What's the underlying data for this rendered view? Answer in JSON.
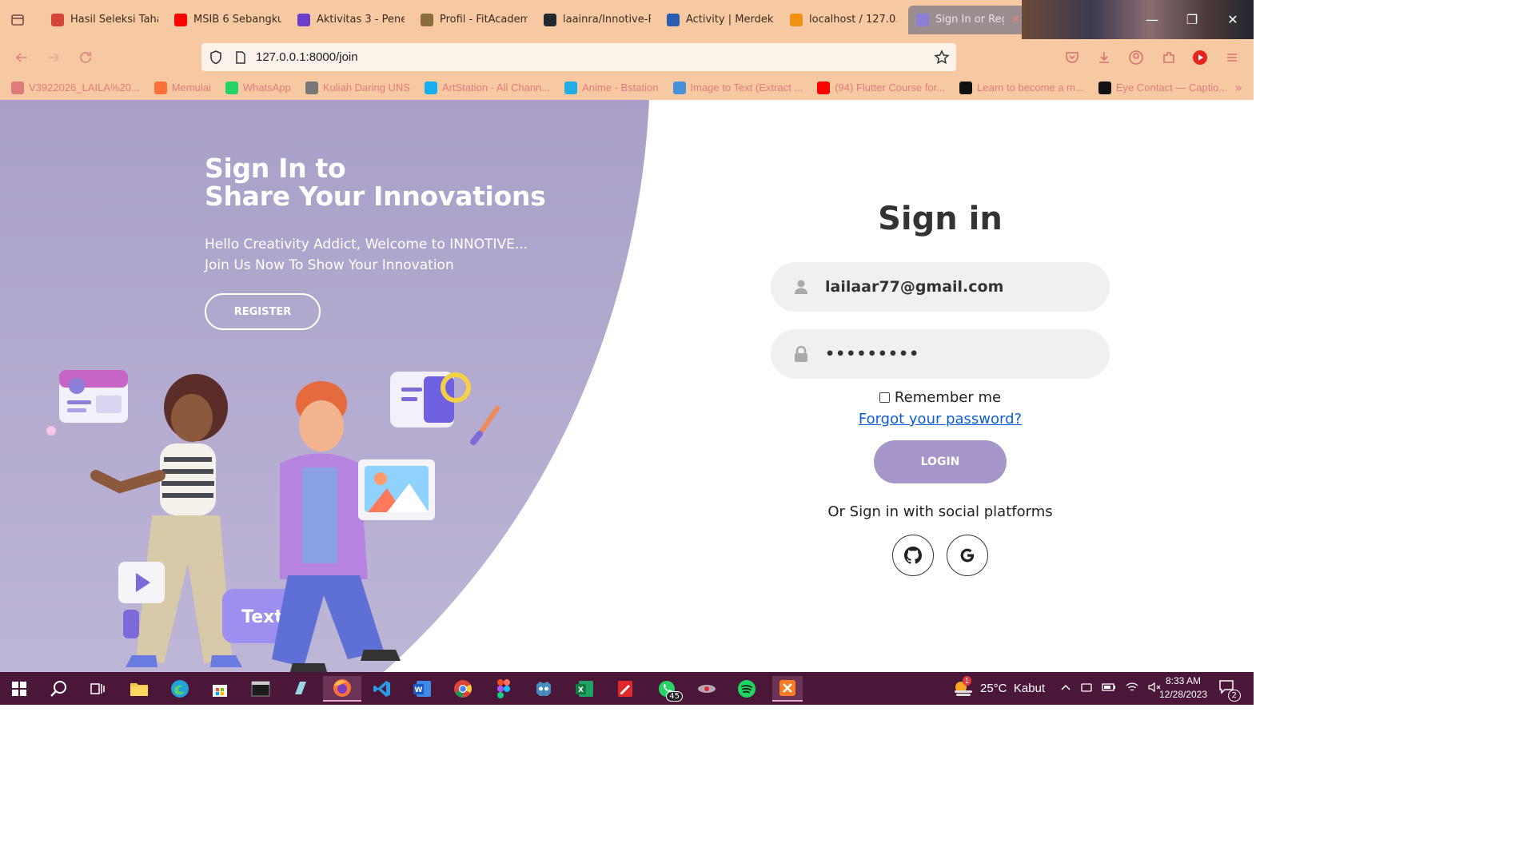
{
  "browser": {
    "tabs": [
      {
        "label": "Hasil Seleksi Tahap",
        "icon": "gmail-icon",
        "color": "#d44638"
      },
      {
        "label": "MSIB 6 Sebangku",
        "icon": "youtube-icon",
        "color": "#ff0000"
      },
      {
        "label": "Aktivitas 3 - Pener",
        "icon": "square-icon",
        "color": "#6b3ec9"
      },
      {
        "label": "Profil - FitAcadem",
        "icon": "cap-icon",
        "color": "#8a6d3b"
      },
      {
        "label": "laainra/Innotive-P",
        "icon": "github-icon",
        "color": "#24292f"
      },
      {
        "label": "Activity | Merdeka",
        "icon": "kampus-icon",
        "color": "#2a5db0"
      },
      {
        "label": "localhost / 127.0.0",
        "icon": "phpmyadmin-icon",
        "color": "#f29111"
      },
      {
        "label": "Sign In or Regi",
        "icon": "loading-icon",
        "color": "#8a7ed6",
        "active": true
      }
    ],
    "url": "127.0.0.1:8000/join",
    "bookmarks": [
      {
        "label": "V3922026_LAILA%20...",
        "icon": "globe-icon",
        "color": "#e07b7b"
      },
      {
        "label": "Memulai",
        "icon": "firefox-icon",
        "color": "#ff7139"
      },
      {
        "label": "WhatsApp",
        "icon": "whatsapp-icon",
        "color": "#25d366"
      },
      {
        "label": "Kuliah Daring UNS",
        "icon": "uns-icon",
        "color": "#777777"
      },
      {
        "label": "ArtStation - All Chann...",
        "icon": "artstation-icon",
        "color": "#13aff0"
      },
      {
        "label": "Anime - Bstation",
        "icon": "bstation-icon",
        "color": "#23ade5"
      },
      {
        "label": "Image to Text (Extract ...",
        "icon": "image-text-icon",
        "color": "#4a90d9"
      },
      {
        "label": "(94) Flutter Course for...",
        "icon": "youtube-icon",
        "color": "#ff0000"
      },
      {
        "label": "Learn to become a m...",
        "icon": "roadmap-icon",
        "color": "#111111"
      },
      {
        "label": "Eye Contact — Captio...",
        "icon": "captions-icon",
        "color": "#111111"
      }
    ]
  },
  "hero": {
    "title_line1": "Sign In to",
    "title_line2": "Share Your Innovations",
    "subtitle_line1": "Hello Creativity Addict, Welcome to INNOTIVE...",
    "subtitle_line2": "Join Us Now To Show Your Innovation",
    "register_label": "REGISTER",
    "illustration_text": "Text"
  },
  "form": {
    "title": "Sign in",
    "email_value": "lailaar77@gmail.com",
    "password_value": "•••••••••",
    "remember_label": "Remember me",
    "forgot_label": "Forgot your password?",
    "login_label": "LOGIN",
    "social_text": "Or Sign in with social platforms"
  },
  "colors": {
    "accent": "#a595c8",
    "hero_bg": "#a99fc8",
    "browser_chrome": "#f7c9a3",
    "taskbar": "#4a1738",
    "link": "#0b5ed7"
  },
  "taskbar": {
    "whatsapp_badge": "45",
    "weather_alert": "1",
    "weather": "25°C  Kabut",
    "time": "8:33 AM",
    "date": "12/28/2023",
    "notifications": "2"
  }
}
